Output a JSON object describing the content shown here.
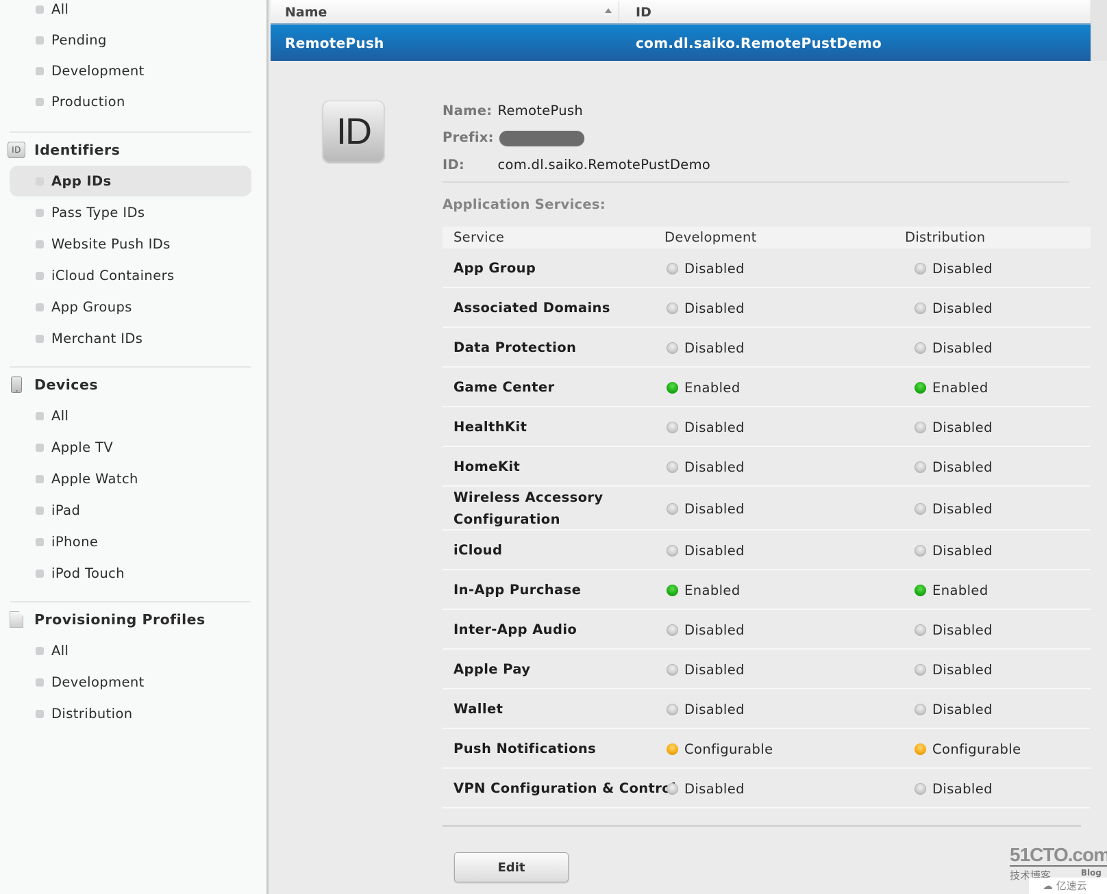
{
  "sidebar": {
    "certificates_items": [
      {
        "label": "All"
      },
      {
        "label": "Pending"
      },
      {
        "label": "Development"
      },
      {
        "label": "Production"
      }
    ],
    "identifiers": {
      "title": "Identifiers",
      "icon": "id-badge-icon",
      "icon_text": "ID",
      "items": [
        {
          "label": "App IDs",
          "selected": true
        },
        {
          "label": "Pass Type IDs"
        },
        {
          "label": "Website Push IDs"
        },
        {
          "label": "iCloud Containers"
        },
        {
          "label": "App Groups"
        },
        {
          "label": "Merchant IDs"
        }
      ]
    },
    "devices": {
      "title": "Devices",
      "icon": "device-icon",
      "items": [
        {
          "label": "All"
        },
        {
          "label": "Apple TV"
        },
        {
          "label": "Apple Watch"
        },
        {
          "label": "iPad"
        },
        {
          "label": "iPhone"
        },
        {
          "label": "iPod Touch"
        }
      ]
    },
    "profiles": {
      "title": "Provisioning Profiles",
      "icon": "document-icon",
      "items": [
        {
          "label": "All"
        },
        {
          "label": "Development"
        },
        {
          "label": "Distribution"
        }
      ]
    }
  },
  "list": {
    "columns": {
      "name": "Name",
      "id": "ID"
    },
    "sort": "ascending",
    "selected_row": {
      "name": "RemotePush",
      "id": "com.dl.saiko.RemotePustDemo"
    }
  },
  "detail": {
    "icon_text": "ID",
    "name_label": "Name:",
    "name_value": "RemotePush",
    "prefix_label": "Prefix:",
    "prefix_value": "[redacted]",
    "id_label": "ID:",
    "id_value": "com.dl.saiko.RemotePustDemo",
    "services_title": "Application Services:",
    "table_headers": {
      "service": "Service",
      "development": "Development",
      "distribution": "Distribution"
    },
    "services": [
      {
        "name": "App Group",
        "dev": "Disabled",
        "dist": "Disabled"
      },
      {
        "name": "Associated Domains",
        "dev": "Disabled",
        "dist": "Disabled"
      },
      {
        "name": "Data Protection",
        "dev": "Disabled",
        "dist": "Disabled"
      },
      {
        "name": "Game Center",
        "dev": "Enabled",
        "dist": "Enabled"
      },
      {
        "name": "HealthKit",
        "dev": "Disabled",
        "dist": "Disabled"
      },
      {
        "name": "HomeKit",
        "dev": "Disabled",
        "dist": "Disabled"
      },
      {
        "name": "Wireless Accessory Configuration",
        "dev": "Disabled",
        "dist": "Disabled"
      },
      {
        "name": "iCloud",
        "dev": "Disabled",
        "dist": "Disabled"
      },
      {
        "name": "In-App Purchase",
        "dev": "Enabled",
        "dist": "Enabled"
      },
      {
        "name": "Inter-App Audio",
        "dev": "Disabled",
        "dist": "Disabled"
      },
      {
        "name": "Apple Pay",
        "dev": "Disabled",
        "dist": "Disabled"
      },
      {
        "name": "Wallet",
        "dev": "Disabled",
        "dist": "Disabled"
      },
      {
        "name": "Push Notifications",
        "dev": "Configurable",
        "dist": "Configurable"
      },
      {
        "name": "VPN Configuration & Control",
        "dev": "Disabled",
        "dist": "Disabled"
      }
    ],
    "status_colors": {
      "Enabled": "#1fae18",
      "Disabled": "#c4c4c4",
      "Configurable": "#f3aa12"
    },
    "edit_label": "Edit"
  },
  "watermark": {
    "main": "51CTO.com",
    "sub": "技术博客",
    "blog": "Blog",
    "cloud": "亿速云"
  }
}
